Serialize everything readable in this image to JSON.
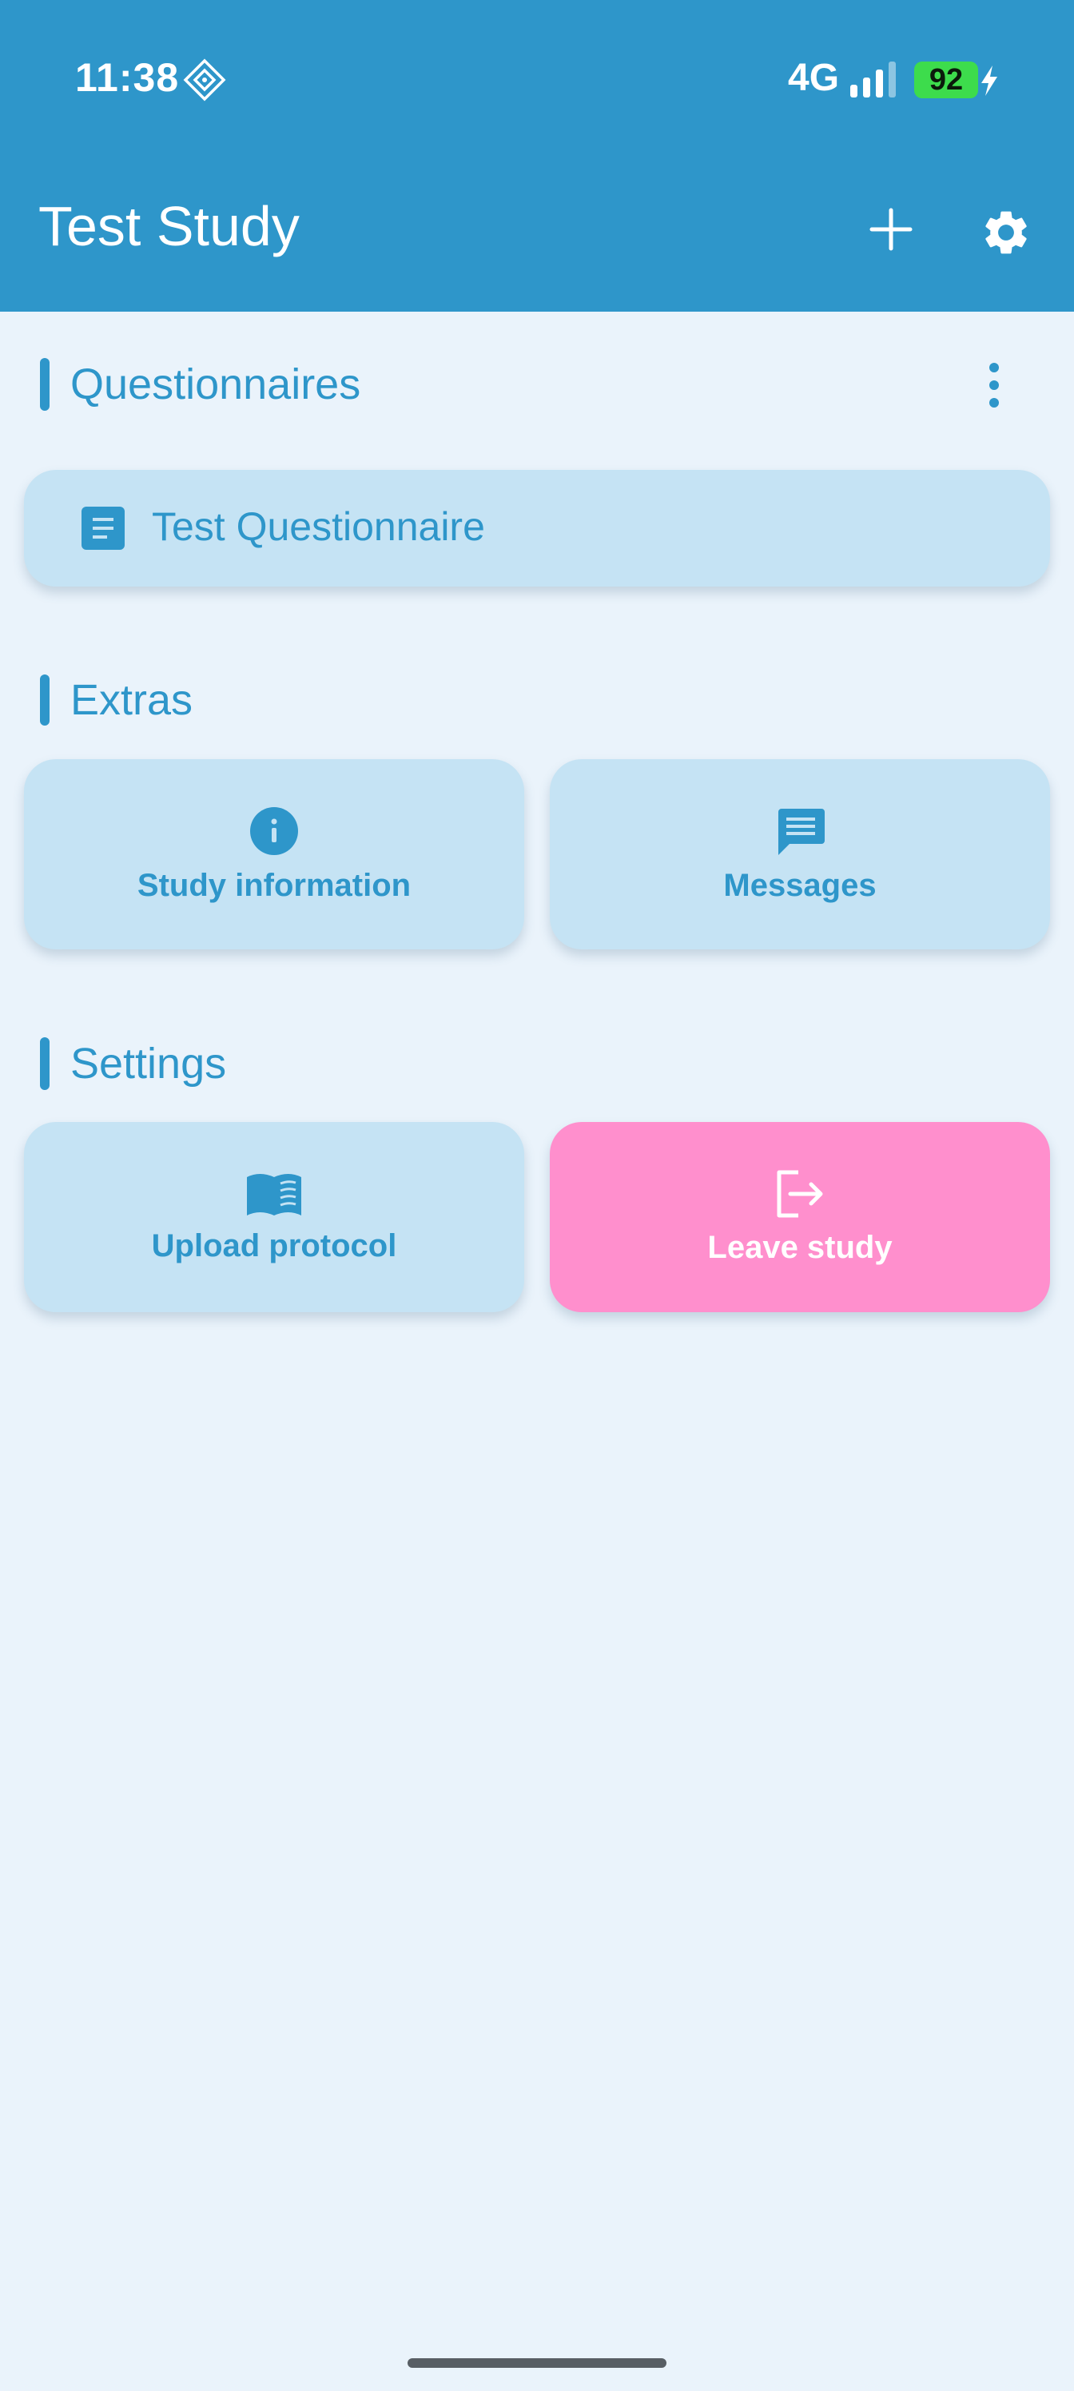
{
  "status_bar": {
    "time": "11:38",
    "network": "4G",
    "battery_level": "92",
    "icons": [
      "diamond-icon",
      "signal-icon",
      "charging-icon"
    ]
  },
  "app_bar": {
    "title": "Test Study",
    "actions": [
      "add-icon",
      "settings-icon"
    ]
  },
  "sections": {
    "questionnaires": {
      "title": "Questionnaires",
      "items": [
        {
          "label": "Test Questionnaire",
          "icon": "document-icon"
        }
      ]
    },
    "extras": {
      "title": "Extras",
      "tiles": [
        {
          "label": "Study information",
          "icon": "info-icon"
        },
        {
          "label": "Messages",
          "icon": "message-icon"
        }
      ]
    },
    "settings": {
      "title": "Settings",
      "tiles": [
        {
          "label": "Upload protocol",
          "icon": "book-icon"
        },
        {
          "label": "Leave study",
          "icon": "exit-icon"
        }
      ]
    }
  },
  "colors": {
    "primary": "#2E96CA",
    "background": "#EAF3FB",
    "card": "#C5E3F4",
    "danger_card": "#FF8FCD",
    "battery": "#3DDC4C"
  }
}
